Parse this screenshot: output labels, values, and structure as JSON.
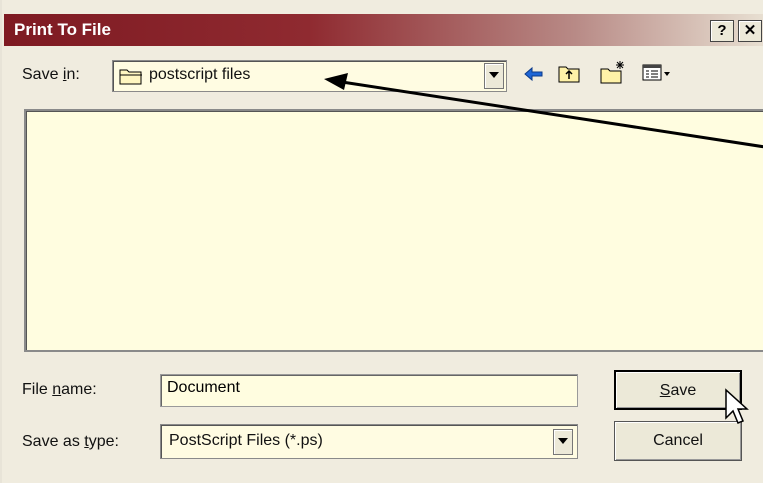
{
  "window": {
    "title": "Print To File",
    "help_label": "?",
    "close_label": "✕"
  },
  "save_in": {
    "prefix": "Save ",
    "accel": "i",
    "suffix": "n:",
    "value": "postscript files"
  },
  "toolbar": {
    "back_icon": "back-arrow-icon",
    "up_icon": "up-folder-icon",
    "new_folder_icon": "new-folder-icon",
    "views_icon": "view-menu-icon"
  },
  "file_name": {
    "prefix": "File ",
    "accel": "n",
    "suffix": "ame:",
    "value": "Document"
  },
  "save_type": {
    "prefix": "Save as ",
    "accel": "t",
    "suffix": "ype:",
    "value": "PostScript Files (*.ps)"
  },
  "buttons": {
    "save_accel": "S",
    "save_rest": "ave",
    "cancel": "Cancel"
  },
  "colors": {
    "titlebar": "#7e1a22",
    "field_bg": "#fffde0",
    "dialog_bg": "#f0ecdf"
  }
}
